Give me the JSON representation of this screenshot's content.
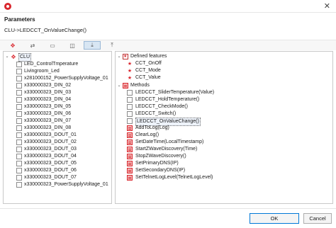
{
  "header": {
    "title": "Parameters",
    "subtitle": "CLU->LEDCCT_OnValueChange()"
  },
  "toolbar": {
    "icons": [
      "move-icon",
      "link-icon",
      "panel-icon",
      "box-icon",
      "import-icon",
      "export-icon"
    ]
  },
  "tree_left": {
    "root": "CLU",
    "items": [
      "LED_ControlTmperature",
      "Livingroom_Led",
      "x281000152_PowerSupplyVoltage_01",
      "x330000323_DIN_02",
      "x330000323_DIN_03",
      "x330000323_DIN_04",
      "x330000323_DIN_05",
      "x330000323_DIN_06",
      "x330000323_DIN_07",
      "x330000323_DIN_08",
      "x330000323_DOUT_01",
      "x330000323_DOUT_02",
      "x330000323_DOUT_03",
      "x330000323_DOUT_04",
      "x330000323_DOUT_05",
      "x330000323_DOUT_06",
      "x330000323_DOUT_07",
      "x330000323_PowerSupplyVoltage_01"
    ]
  },
  "tree_right": {
    "defined_features_label": "Defined features",
    "features": [
      "CCT_OnOff",
      "CCT_Mode",
      "CCT_Value"
    ],
    "methods_label": "Methods",
    "methods": [
      "LEDCCT_SliderTemperature(Value)",
      "LEDCCT_HoldTemperature()",
      "LEDCCT_CheckMode()",
      "LEDCCT_Switch()",
      "LEDCCT_OnValueChange()",
      "AddToLog(Log)",
      "ClearLog()",
      "SetDateTime(LocalTimestamp)",
      "StartZWaveDiscovery(Time)",
      "StopZWaveDiscovery()",
      "SetPrimaryDNS(IP)",
      "SetSecondaryDNS(IP)",
      "SetTelnetLogLevel(TelnetLogLevel)"
    ],
    "selected_method_index": 4
  },
  "footer": {
    "ok_label": "OK",
    "cancel_label": "Cancel"
  }
}
